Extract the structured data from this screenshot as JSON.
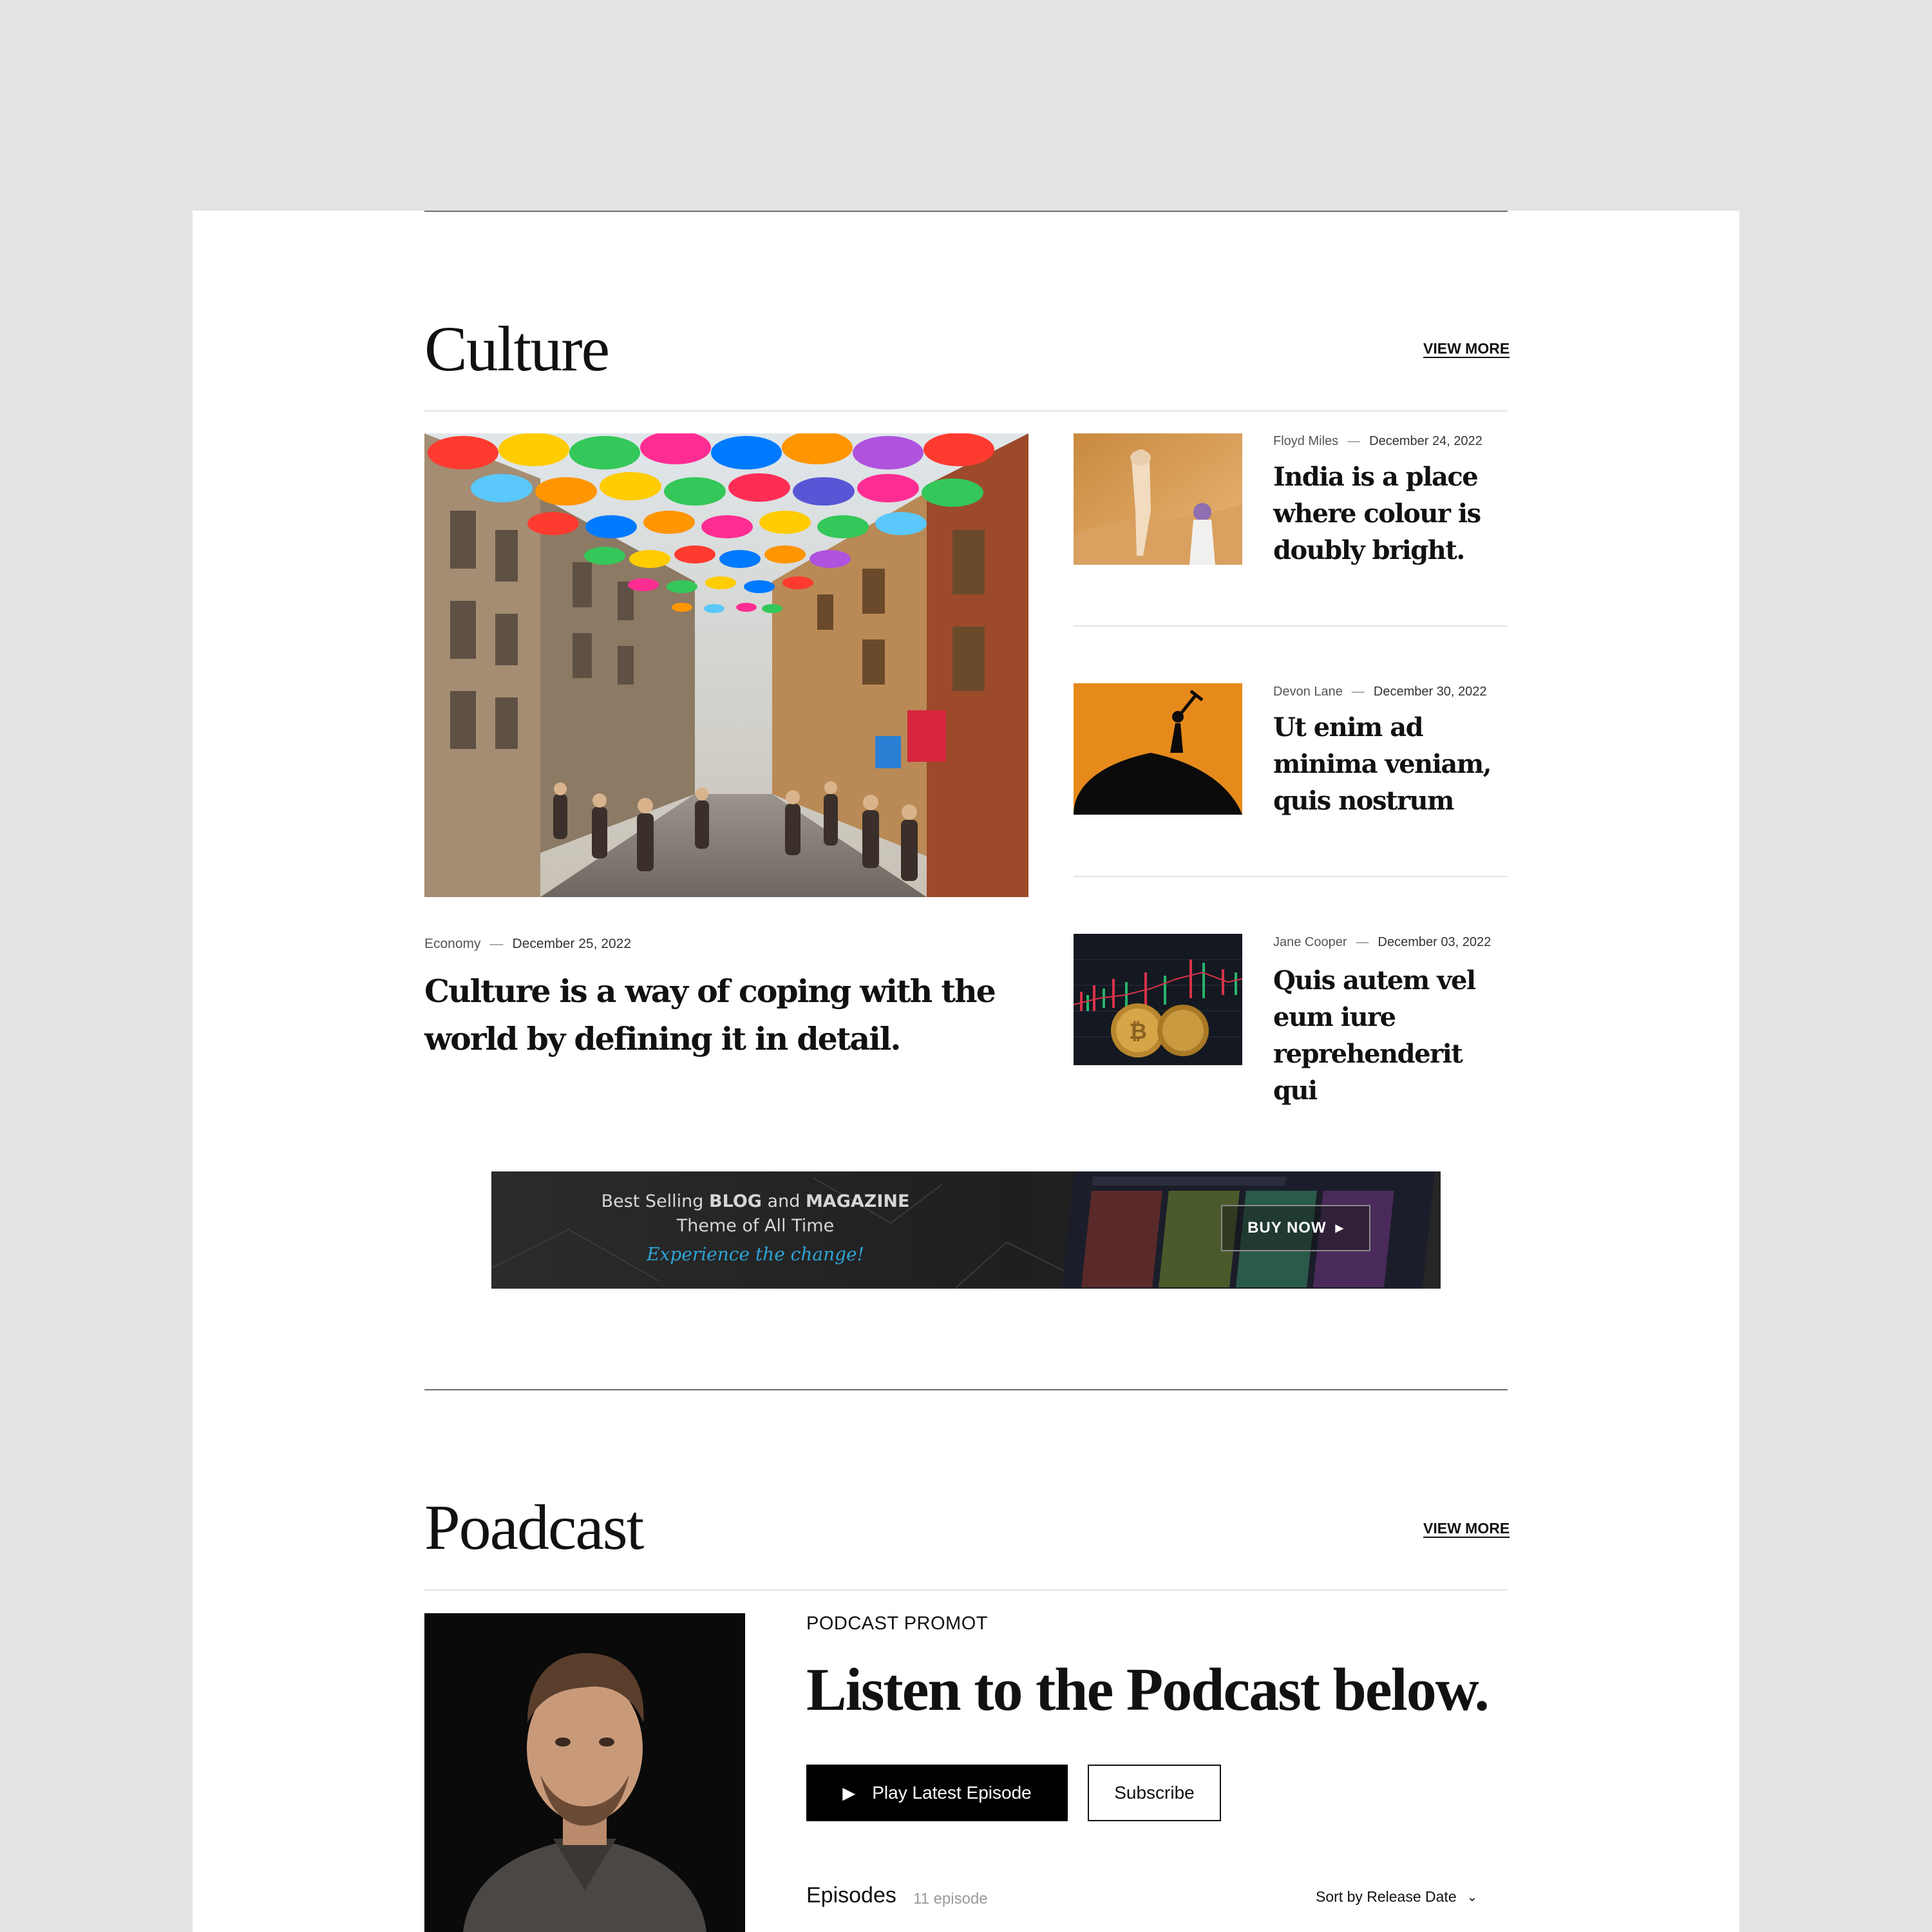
{
  "culture": {
    "title": "Culture",
    "view_more": "VIEW MORE",
    "featured": {
      "category": "Economy",
      "date": "December 25, 2022",
      "title": "Culture is a way of coping with the world by defining it in detail."
    },
    "side_posts": [
      {
        "author": "Floyd Miles",
        "date": "December 24, 2022",
        "title": "India is a place where colour is doubly bright."
      },
      {
        "author": "Devon Lane",
        "date": "December 30, 2022",
        "title": "Ut enim ad minima veniam, quis nostrum"
      },
      {
        "author": "Jane Cooper",
        "date": "December 03, 2022",
        "title": "Quis autem vel eum iure reprehenderit qui"
      }
    ],
    "separator": "—"
  },
  "ad_banner": {
    "line1_prefix": "Best Selling ",
    "line1_blog": "BLOG",
    "line1_and": " and ",
    "line1_magazine": "MAGAZINE",
    "line2": "Theme of All Time",
    "tagline": "Experience the change!",
    "button": "BUY NOW"
  },
  "podcast": {
    "title": "Poadcast",
    "view_more": "VIEW MORE",
    "eyebrow": "PODCAST PROMOT",
    "headline": "Listen to the Podcast below.",
    "play_button": "Play Latest Episode",
    "subscribe_button": "Subscribe",
    "episodes_label": "Episodes",
    "episodes_count": "11 episode",
    "sort_label": "Sort by Release Date"
  },
  "colors": {
    "background": "#e3e3e3",
    "card": "#ffffff",
    "text": "#111111",
    "accent_orange": "#e68a1c",
    "tagline_blue": "#2fa4d6"
  }
}
